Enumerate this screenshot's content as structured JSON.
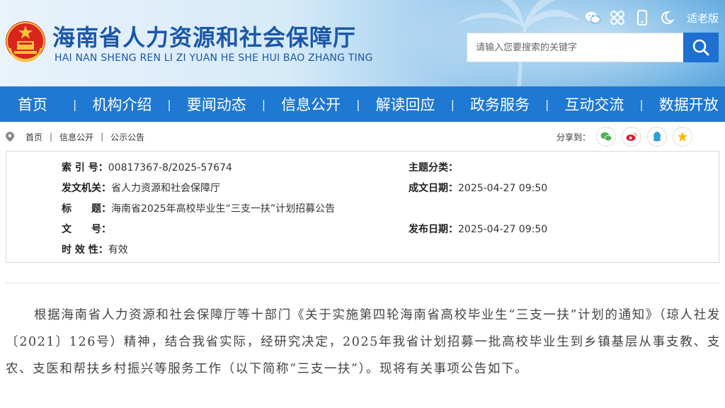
{
  "header": {
    "title": "海南省人力资源和社会保障厅",
    "pinyin": "HAI NAN SHENG REN LI ZI YUAN HE SHE HUI BAO ZHANG TING",
    "elder_mode": "适老版",
    "search_placeholder": "请输入您要搜索的关键字",
    "tool_icons": [
      "wechat-icon",
      "miniprogram-icon",
      "mobile-icon",
      "night-mode-icon"
    ]
  },
  "nav": {
    "items": [
      {
        "label": "首页"
      },
      {
        "label": "机构介绍"
      },
      {
        "label": "要闻动态"
      },
      {
        "label": "信息公开"
      },
      {
        "label": "解读回应"
      },
      {
        "label": "政务服务"
      },
      {
        "label": "互动交流"
      },
      {
        "label": "数据开放"
      }
    ]
  },
  "breadcrumb": {
    "items": [
      "首页",
      "信息公开",
      "公示公告"
    ],
    "share_label": "分享到："
  },
  "meta": {
    "index_label": "索 引 号：",
    "index_value": "00817367-8/2025-57674",
    "topic_label": "主题分类：",
    "topic_value": "",
    "issuer_label": "发文机关：",
    "issuer_value": "省人力资源和社会保障厅",
    "date_label": "成文日期：",
    "date_value": "2025-04-27 09:50",
    "title_label": "标　　题：",
    "title_value": "海南省2025年高校毕业生“三支一扶”计划招募公告",
    "doc_label": "文　　号：",
    "doc_value": "",
    "publish_label": "发布日期：",
    "publish_value": "2025-04-27 09:50",
    "validity_label": "时 效 性：",
    "validity_value": "有效"
  },
  "body": {
    "paragraph": "根据海南省人力资源和社会保障厅等十部门《关于实施第四轮海南省高校毕业生“三支一扶”计划的通知》（琼人社发〔2021〕126号）精神，结合我省实际，经研究决定，2025年我省计划招募一批高校毕业生到乡镇基层从事支教、支农、支医和帮扶乡村振兴等服务工作（以下简称“三支一扶”）。现将有关事项公告如下。"
  },
  "colors": {
    "nav_bg": "#1f78d1",
    "title_blue": "#1b57a8",
    "search_btn": "#1d6fd0"
  }
}
